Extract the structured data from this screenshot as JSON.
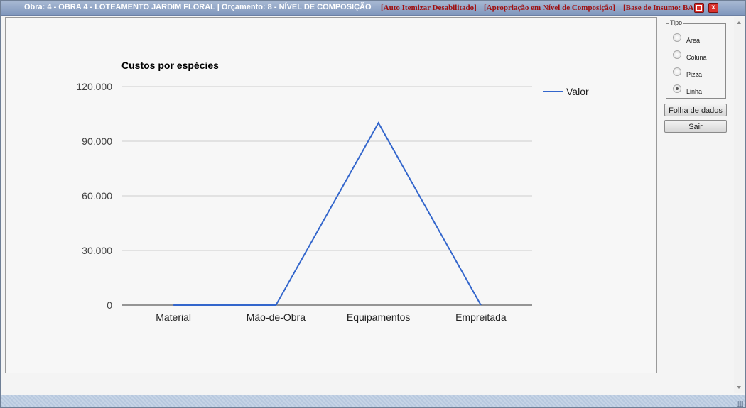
{
  "titlebar": {
    "title": "Obra: 4 - OBRA 4 - LOTEAMENTO JARDIM FLORAL | Orçamento: 8 - NÍVEL DE COMPOSIÇÃO",
    "tag_auto": "[Auto Itemizar Desabilitado]",
    "tag_apropriacao": "[Apropriação em Nível de Composição]",
    "tag_base": "[Base de Insumo: BA",
    "close_glyph": "x"
  },
  "tipo": {
    "legend": "Tipo",
    "options": [
      {
        "label": "Área",
        "checked": false
      },
      {
        "label": "Coluna",
        "checked": false
      },
      {
        "label": "Pizza",
        "checked": false
      },
      {
        "label": "Linha",
        "checked": true
      }
    ]
  },
  "buttons": {
    "folha": "Folha de dados",
    "sair": "Sair"
  },
  "chart_data": {
    "type": "line",
    "title": "Custos por espécies",
    "categories": [
      "Material",
      "Mão-de-Obra",
      "Equipamentos",
      "Empreitada"
    ],
    "series": [
      {
        "name": "Valor",
        "values": [
          0,
          0,
          100000,
          0
        ],
        "color": "#3366cc"
      }
    ],
    "ylim": [
      0,
      120000
    ],
    "yticks": [
      0,
      30000,
      60000,
      90000,
      120000
    ],
    "ytick_labels": [
      "0",
      "30.000",
      "60.000",
      "90.000",
      "120.000"
    ],
    "grid": true,
    "legend_position": "right"
  }
}
